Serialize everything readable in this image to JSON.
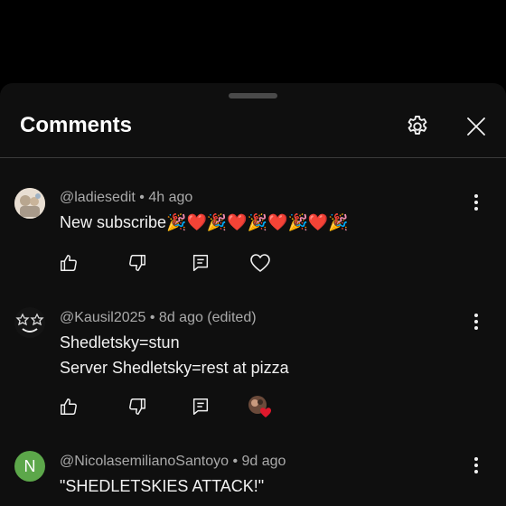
{
  "header": {
    "title": "Comments",
    "settings_icon": "gear-icon",
    "close_icon": "close-icon"
  },
  "colors": {
    "sheet_bg": "#0f0f0f",
    "text_primary": "#f1f1f1",
    "text_secondary": "#aaaaaa",
    "avatar_green": "#5ca74a",
    "heart_red": "#e0182c"
  },
  "comments": [
    {
      "author": "@ladiesedit",
      "time": "4h ago",
      "text_lines": [
        "New subscribe🎉❤️🎉❤️🎉❤️🎉❤️🎉"
      ],
      "actions": [
        "like-icon",
        "dislike-icon",
        "reply-icon",
        "heart-icon"
      ]
    },
    {
      "author": "@Kausil2025",
      "time": "8d ago (edited)",
      "text_lines": [
        "Shedletsky=stun",
        "Server Shedletsky=rest at pizza"
      ],
      "actions": [
        "like-icon",
        "dislike-icon",
        "reply-icon",
        "creator-heart-icon"
      ]
    },
    {
      "author": "@NicolasemilianoSantoyo",
      "time": "9d ago",
      "avatar_letter": "N",
      "text_lines": [
        "\"SHEDLETSKIES ATTACK!\""
      ]
    }
  ],
  "separator": " • "
}
